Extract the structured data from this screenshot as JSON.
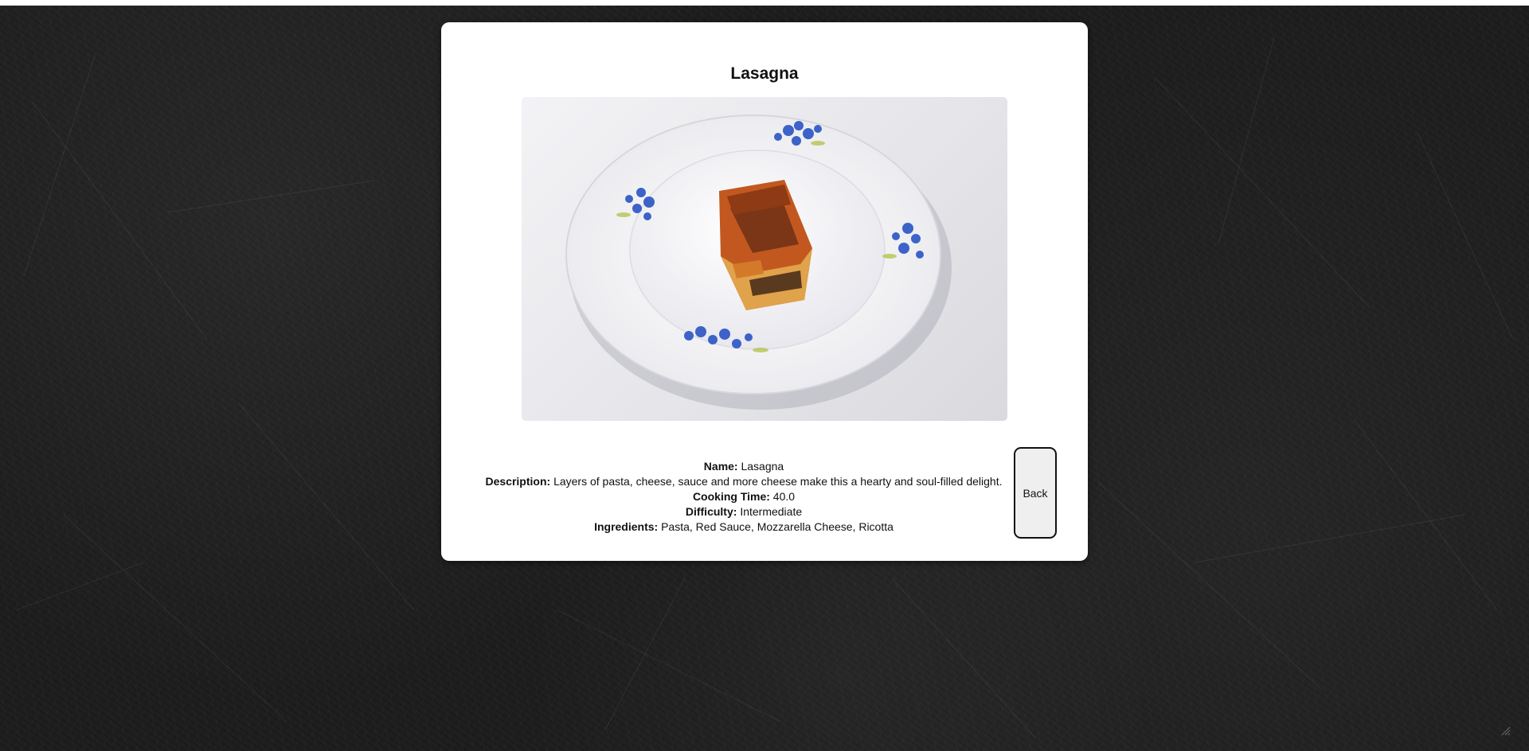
{
  "recipe": {
    "title": "Lasagna",
    "image_alt": "Lasagna on a floral plate",
    "fields": [
      {
        "label": "Name:",
        "value": "Lasagna"
      },
      {
        "label": "Description:",
        "value": "Layers of pasta, cheese, sauce and more cheese make this a hearty and soul-filled delight."
      },
      {
        "label": "Cooking Time:",
        "value": "40.0"
      },
      {
        "label": "Difficulty:",
        "value": "Intermediate"
      },
      {
        "label": "Ingredients:",
        "value": "Pasta, Red Sauce, Mozzarella Cheese, Ricotta"
      }
    ],
    "back_label": "Back"
  },
  "colors": {
    "background": "#1e1e1e",
    "card": "#ffffff",
    "button": "#efefef",
    "text": "#111111"
  }
}
